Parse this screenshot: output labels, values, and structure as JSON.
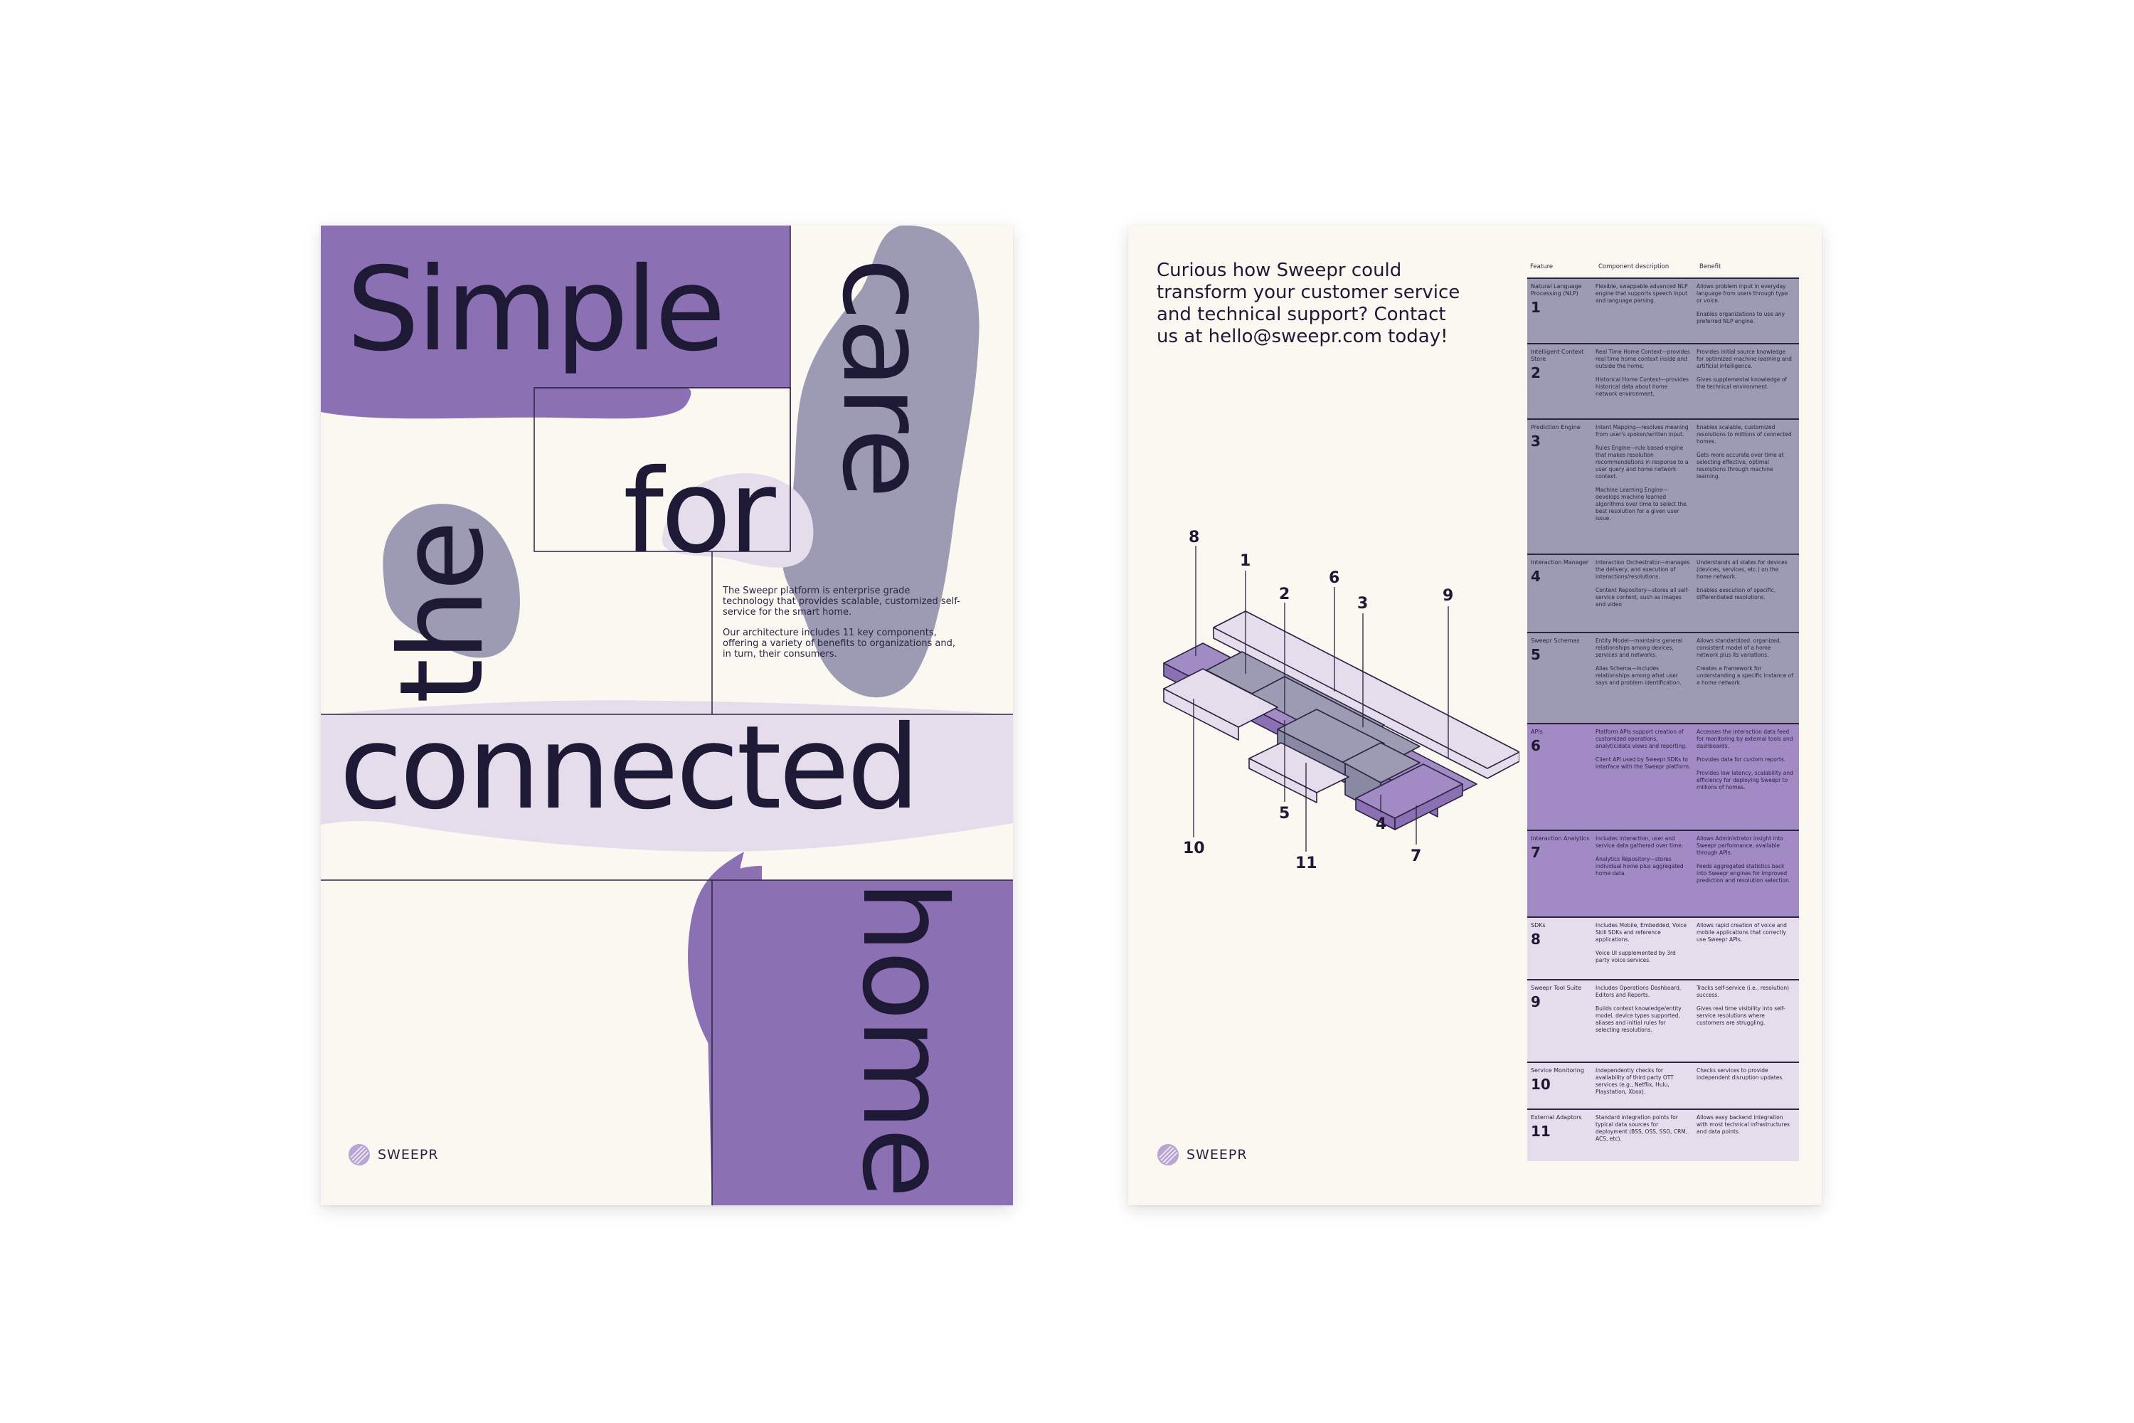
{
  "poster_left": {
    "words": {
      "simple": "Simple",
      "care": "care",
      "for": "for",
      "the": "the",
      "connected": "connected",
      "home": "home"
    },
    "intro": [
      "The Sweepr platform is enterprise grade technology that provides scalable, customized self-service for the smart home.",
      "Our architecture includes 11 key components, offering a variety of benefits to organizations and, in turn, their consumers."
    ],
    "logo_text": "SWEEPR",
    "colors": {
      "purple": "#8b70b3",
      "gray_blue": "#9c9bb3",
      "lavender": "#e6ddec",
      "paper": "#fbf8f2"
    }
  },
  "poster_right": {
    "headline": "Curious how Sweepr could transform your customer service and technical support? Contact us at hello@sweepr.com today!",
    "logo_text": "SWEEPR",
    "diagram_labels": [
      "1",
      "2",
      "3",
      "4",
      "5",
      "6",
      "7",
      "8",
      "9",
      "10",
      "11"
    ],
    "table": {
      "headers": [
        "Feature",
        "Component description",
        "Benefit"
      ],
      "rows": [
        {
          "feature": "Natural Language Processing (NLP)",
          "num": "1",
          "desc": [
            "Flexible, swappable advanced NLP engine that supports speech input and language parsing."
          ],
          "benefit": [
            "Allows problem input in everyday language from users through type or voice.",
            "Enables organizations to use any preferred NLP engine."
          ]
        },
        {
          "feature": "Intelligent Context Store",
          "num": "2",
          "desc": [
            "Real Time Home Context—provides real time home context inside and outside the home.",
            "Historical Home Context—provides historical data about home network environment."
          ],
          "benefit": [
            "Provides initial source knowledge for optimized machine learning and artificial intelligence.",
            "Gives supplemental knowledge of the technical environment."
          ]
        },
        {
          "feature": "Prediction Engine",
          "num": "3",
          "desc": [
            "Intent Mapping—resolves meaning from user's spoken/written input.",
            "Rules Engine—rule based engine that makes resolution recommendations in response to a user query and home network context.",
            "Machine Learning Engine—develops machine learned algorithms over time to select the best resolution for a given user issue."
          ],
          "benefit": [
            "Enables scalable, customized resolutions to millions of connected homes.",
            "Gets more accurate over time at selecting effective, optimal resolutions through machine learning."
          ]
        },
        {
          "feature": "Interaction Manager",
          "num": "4",
          "desc": [
            "Interaction Orchestrator—manages the delivery, and execution of interactions/resolutions.",
            "Content Repository—stores all self-service content, such as images and video"
          ],
          "benefit": [
            "Understands all states for devices (devices, services, etc.) on the home network.",
            "Enables execution of specific, differentiated resolutions."
          ]
        },
        {
          "feature": "Sweepr Schemas",
          "num": "5",
          "desc": [
            "Entity Model—maintains general relationships among devices, services and networks.",
            "Alias Schema—Includes relationships among what user says and problem identification."
          ],
          "benefit": [
            "Allows standardized, organized, consistent model of a home network plus its variations.",
            "Creates a framework for understanding a specific instance of a home network."
          ]
        },
        {
          "feature": "APIs",
          "num": "6",
          "desc": [
            "Platform APIs support creation of customized operations, analytic/data views and reporting.",
            "Client API used by Sweepr SDKs to interface with the Sweepr platform."
          ],
          "benefit": [
            "Accesses the interaction data feed for monitoring by external tools and dashboards.",
            "Provides data for custom reports.",
            "Provides low latency, scalability and efficiency for deploying Sweepr to millions of homes."
          ]
        },
        {
          "feature": "Interaction Analytics",
          "num": "7",
          "desc": [
            "Includes interaction, user and service data gathered over time.",
            "Analytics Repository—stores individual home plus aggregated home data."
          ],
          "benefit": [
            "Allows Administrator insight into Sweepr performance, available through APIs.",
            "Feeds aggregated statistics back into Sweepr engines for improved prediction and resolution selection."
          ]
        },
        {
          "feature": "SDKs",
          "num": "8",
          "desc": [
            "Includes Mobile, Embedded, Voice Skill SDKs and reference applications.",
            "Voice UI supplemented by 3rd party voice services."
          ],
          "benefit": [
            "Allows rapid creation of voice and mobile applications that correctly use Sweepr APIs."
          ]
        },
        {
          "feature": "Sweepr Tool Suite",
          "num": "9",
          "desc": [
            "Includes Operations Dashboard, Editors and Reports.",
            "Builds context knowledge/entity model, device types supported, aliases and initial rules for selecting resolutions."
          ],
          "benefit": [
            "Tracks self-service (i.e., resolution) success.",
            "Gives real time visibility into self-service resolutions where customers are struggling."
          ]
        },
        {
          "feature": "Service Monitoring",
          "num": "10",
          "desc": [
            "Independently checks for availability of third party OTT services (e.g., Netflix, Hulu, Playstation, Xbox)."
          ],
          "benefit": [
            "Checks services to provide independent disruption updates."
          ]
        },
        {
          "feature": "External Adaptors",
          "num": "11",
          "desc": [
            "Standard integration points for typical data sources for deployment (BSS, OSS, SSO, CRM, ACS, etc)."
          ],
          "benefit": [
            "Allows easy backend integration with most technical infrastructures and data points."
          ]
        }
      ],
      "row_colors": [
        "#9c9bb3",
        "#9c9bb3",
        "#9c9bb3",
        "#9c9bb3",
        "#9c9bb3",
        "#a28ac4",
        "#a28ac4",
        "#e6ddec",
        "#e6ddec",
        "#e6ddec",
        "#e6ddec"
      ]
    }
  }
}
